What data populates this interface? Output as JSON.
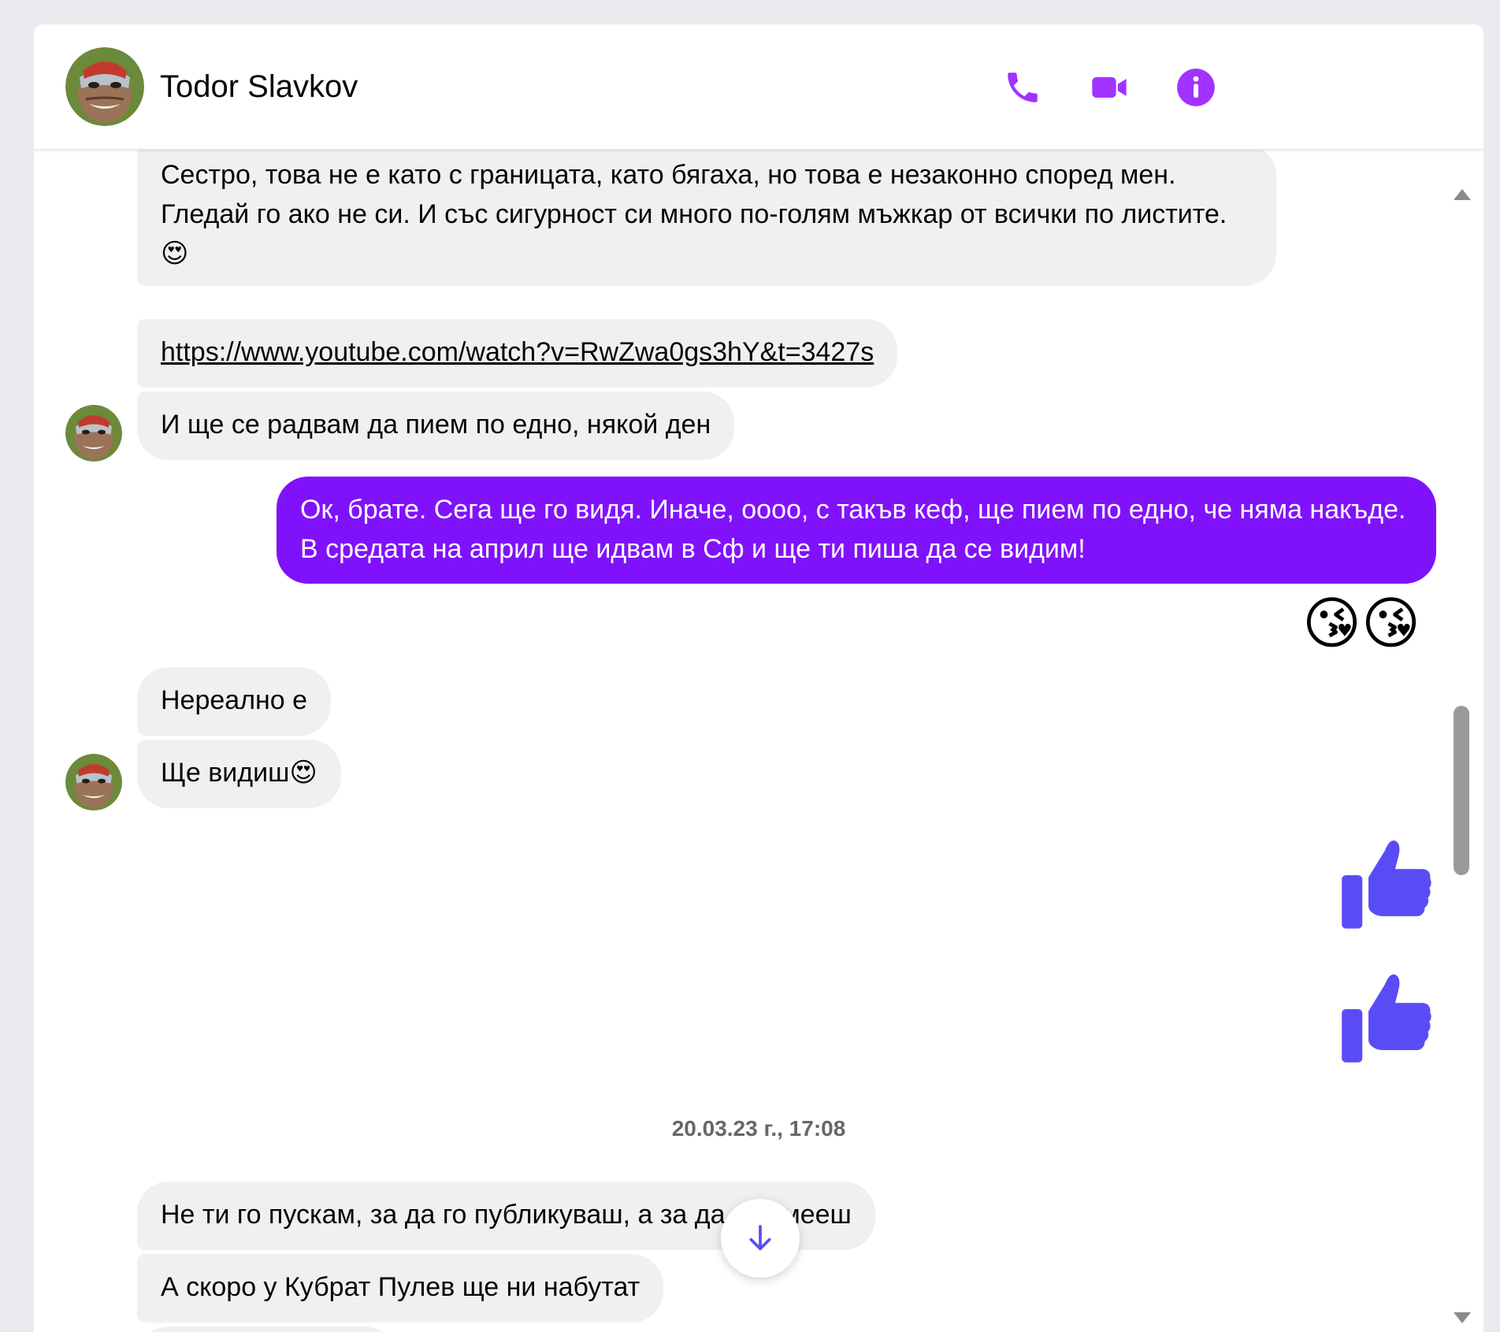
{
  "header": {
    "contact_name": "Todor Slavkov",
    "icons": [
      "phone-icon",
      "video-icon",
      "info-icon"
    ],
    "accent_color": "#a033ff"
  },
  "messages": [
    {
      "sender": "contact",
      "text": "Сестро, това не е като с границата, като бягаха, но това е незаконно според мен. Гледай го ако не си. И със сигурност си много по-голям мъжкар от всички по листите.",
      "emoji": "😍"
    },
    {
      "sender": "contact",
      "text": "https://www.youtube.com/watch?v=RwZwa0gs3hY&t=3427s",
      "type": "link"
    },
    {
      "sender": "contact",
      "text": "И ще се радвам да пием по едно, някой ден"
    },
    {
      "sender": "me",
      "text": "Ок, брате. Сега ще го видя. Иначе, оооо, с такъв кеф, ще пием по едно, че няма накъде. В средата на април ще идвам в Сф и ще ти пиша да се видим!"
    },
    {
      "sender": "me",
      "type": "emoji",
      "text": "😘😘"
    },
    {
      "sender": "contact",
      "text": "Нереално е"
    },
    {
      "sender": "contact",
      "text": "Ще видиш",
      "emoji": "😍"
    },
    {
      "sender": "me",
      "type": "like"
    },
    {
      "sender": "me",
      "type": "like"
    },
    {
      "sender": "contact",
      "text": "Не ти го пускам, за да го публикуваш, а за да се смееш"
    },
    {
      "sender": "contact",
      "text": "А скоро у Кубрат Пулев ще ни набутат"
    }
  ],
  "timestamp": "20.03.23 г., 17:08",
  "colors": {
    "outgoing_bubble": "#8012fb",
    "incoming_bubble": "#f0f0f0",
    "like": "#5a4cf5"
  }
}
